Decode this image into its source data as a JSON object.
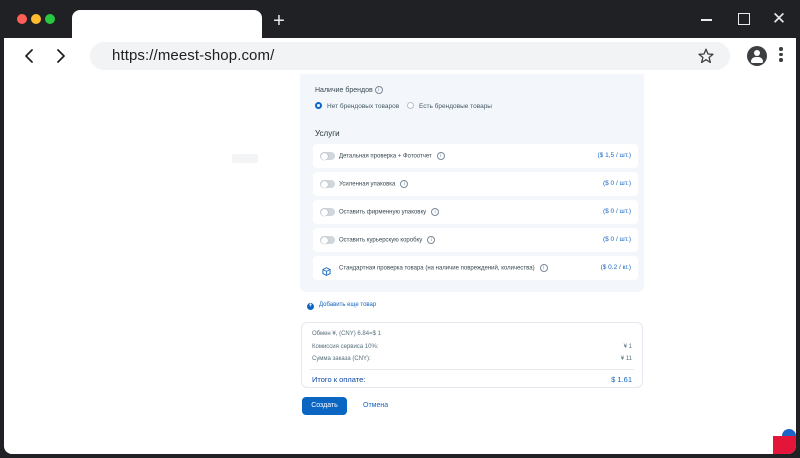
{
  "browser": {
    "url": "https://meest-shop.com/",
    "new_tab_symbol": "+",
    "close_symbol": "✕",
    "colors": {
      "chrome": "#202124",
      "accent": "#0a66c2"
    }
  },
  "brands": {
    "label": "Наличие брендов",
    "info": "i",
    "options": [
      {
        "label": "Нет брендовых товаров",
        "selected": true
      },
      {
        "label": "Есть брендовые товары",
        "selected": false
      }
    ]
  },
  "services": {
    "title": "Услуги",
    "items": [
      {
        "label": "Детальная проверка + Фотоотчет",
        "price": "($ 1,5 / шт.)",
        "control": "toggle",
        "enabled": false
      },
      {
        "label": "Усиленная упаковка",
        "price": "($ 0 / шт.)",
        "control": "toggle",
        "enabled": false
      },
      {
        "label": "Оставить фирменную упаковку",
        "price": "($ 0 / шт.)",
        "control": "toggle",
        "enabled": false
      },
      {
        "label": "Оставить курьерскую коробку",
        "price": "($ 0 / шт.)",
        "control": "toggle",
        "enabled": false
      },
      {
        "label": "Стандартная проверка товара (на наличие повреждений, количества)",
        "price": "($ 0.2 / кг.)",
        "control": "box-icon",
        "enabled": true
      }
    ]
  },
  "add_item": {
    "label": "Добавить еще товар",
    "icon": "plus-icon"
  },
  "summary": {
    "rows": [
      {
        "label": "Обмен ¥, (CNY) 6.84=$ 1",
        "value": ""
      },
      {
        "label": "Комиссия сервиса 10%:",
        "value": "¥ 1"
      },
      {
        "label": "Сумма заказа (CNY):",
        "value": "¥ 11"
      }
    ],
    "total_label": "Итого к оплате:",
    "total_value": "$ 1.61"
  },
  "actions": {
    "create": "Создать",
    "cancel": "Отмена"
  }
}
